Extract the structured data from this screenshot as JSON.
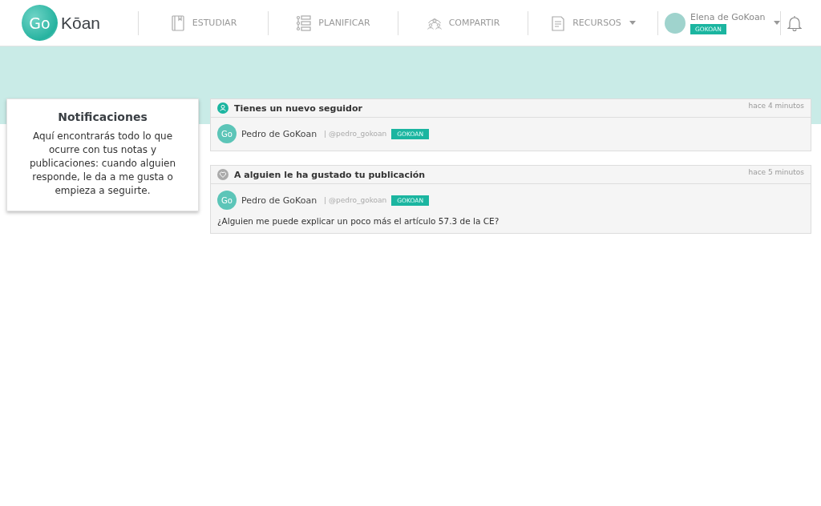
{
  "logo": {
    "mark": "Go",
    "wordmark": "Kōan"
  },
  "nav": [
    {
      "label": "ESTUDIAR",
      "kind": "book"
    },
    {
      "label": "PLANIFICAR",
      "kind": "plan"
    },
    {
      "label": "COMPARTIR",
      "kind": "people"
    },
    {
      "label": "RECURSOS",
      "kind": "doc",
      "dropdown": true
    }
  ],
  "user": {
    "name": "Elena de GoKoan",
    "badge": "GOKOAN"
  },
  "sidebar": {
    "title": "Notificaciones",
    "text": "Aquí encontrarás todo lo que ocurre con tus notas y publicaciones: cuando alguien responde, le da a me gusta o empieza a seguirte."
  },
  "notifications": [
    {
      "kind": "follow",
      "title": "Tienes un nuevo seguidor",
      "time": "hace 4 minutos",
      "avatar": "Go",
      "name": "Pedro de GoKoan",
      "handle": "| @pedro_gokoan",
      "badge": "GOKOAN"
    },
    {
      "kind": "like",
      "title": "A alguien le ha gustado tu publicación",
      "time": "hace 5 minutos",
      "avatar": "Go",
      "name": "Pedro de GoKoan",
      "handle": "| @pedro_gokoan",
      "badge": "GOKOAN",
      "text": "¿Alguien me puede explicar un poco más el artículo 57.3 de la CE?"
    }
  ]
}
